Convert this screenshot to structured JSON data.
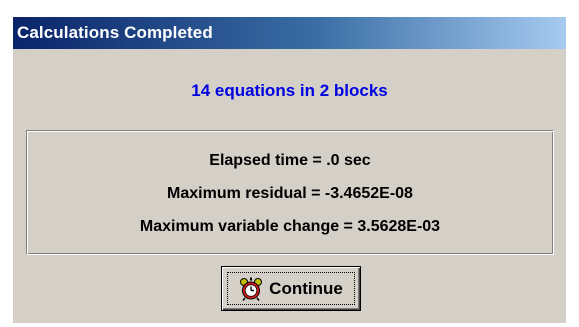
{
  "dialog": {
    "title": "Calculations Completed",
    "headline": "14 equations in 2 blocks",
    "stats": {
      "elapsed": "Elapsed time = .0 sec",
      "residual": "Maximum residual = -3.4652E-08",
      "change": "Maximum variable change = 3.5628E-03"
    },
    "continue_button": {
      "label": "Continue",
      "icon": "alarm-clock-icon"
    }
  },
  "colors": {
    "titlebar_start": "#0a246a",
    "titlebar_end": "#a6caf0",
    "headline": "#0000e0",
    "dialog_face": "#d4d0c8"
  }
}
